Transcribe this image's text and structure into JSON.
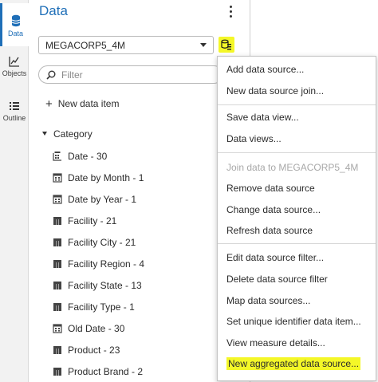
{
  "rail": {
    "data_label": "Data",
    "objects_label": "Objects",
    "outline_label": "Outline"
  },
  "pane": {
    "title": "Data",
    "datasource": "MEGACORP5_4M",
    "filter_placeholder": "Filter",
    "new_item_label": "New data item",
    "category_label": "Category",
    "items": [
      {
        "label": "Date - 30",
        "icon": "date-icon"
      },
      {
        "label": "Date by Month - 1",
        "icon": "calendar-icon"
      },
      {
        "label": "Date by Year - 1",
        "icon": "calendar-icon"
      },
      {
        "label": "Facility - 21",
        "icon": "category-icon"
      },
      {
        "label": "Facility City - 21",
        "icon": "category-icon"
      },
      {
        "label": "Facility Region - 4",
        "icon": "category-icon"
      },
      {
        "label": "Facility State - 13",
        "icon": "category-icon"
      },
      {
        "label": "Facility Type - 1",
        "icon": "category-icon"
      },
      {
        "label": "Old Date - 30",
        "icon": "calendar-icon"
      },
      {
        "label": "Product - 23",
        "icon": "category-icon"
      },
      {
        "label": "Product Brand - 2",
        "icon": "category-icon"
      }
    ]
  },
  "menu": {
    "items": [
      {
        "label": "Add data source...",
        "enabled": true
      },
      {
        "label": "New data source join...",
        "enabled": true
      },
      {
        "label": "Save data view...",
        "enabled": true
      },
      {
        "label": "Data views...",
        "enabled": true
      },
      {
        "label": "Join data to MEGACORP5_4M",
        "enabled": false
      },
      {
        "label": "Remove data source",
        "enabled": true
      },
      {
        "label": "Change data source...",
        "enabled": true
      },
      {
        "label": "Refresh data source",
        "enabled": true
      },
      {
        "label": "Edit data source filter...",
        "enabled": true
      },
      {
        "label": "Delete data source filter",
        "enabled": true
      },
      {
        "label": "Map data sources...",
        "enabled": true
      },
      {
        "label": "Set unique identifier data item...",
        "enabled": true
      },
      {
        "label": "View measure details...",
        "enabled": true
      },
      {
        "label": "New aggregated data source...",
        "enabled": true,
        "highlighted": true
      }
    ]
  },
  "colors": {
    "accent": "#1f6fb8",
    "highlight": "#f4f728"
  }
}
